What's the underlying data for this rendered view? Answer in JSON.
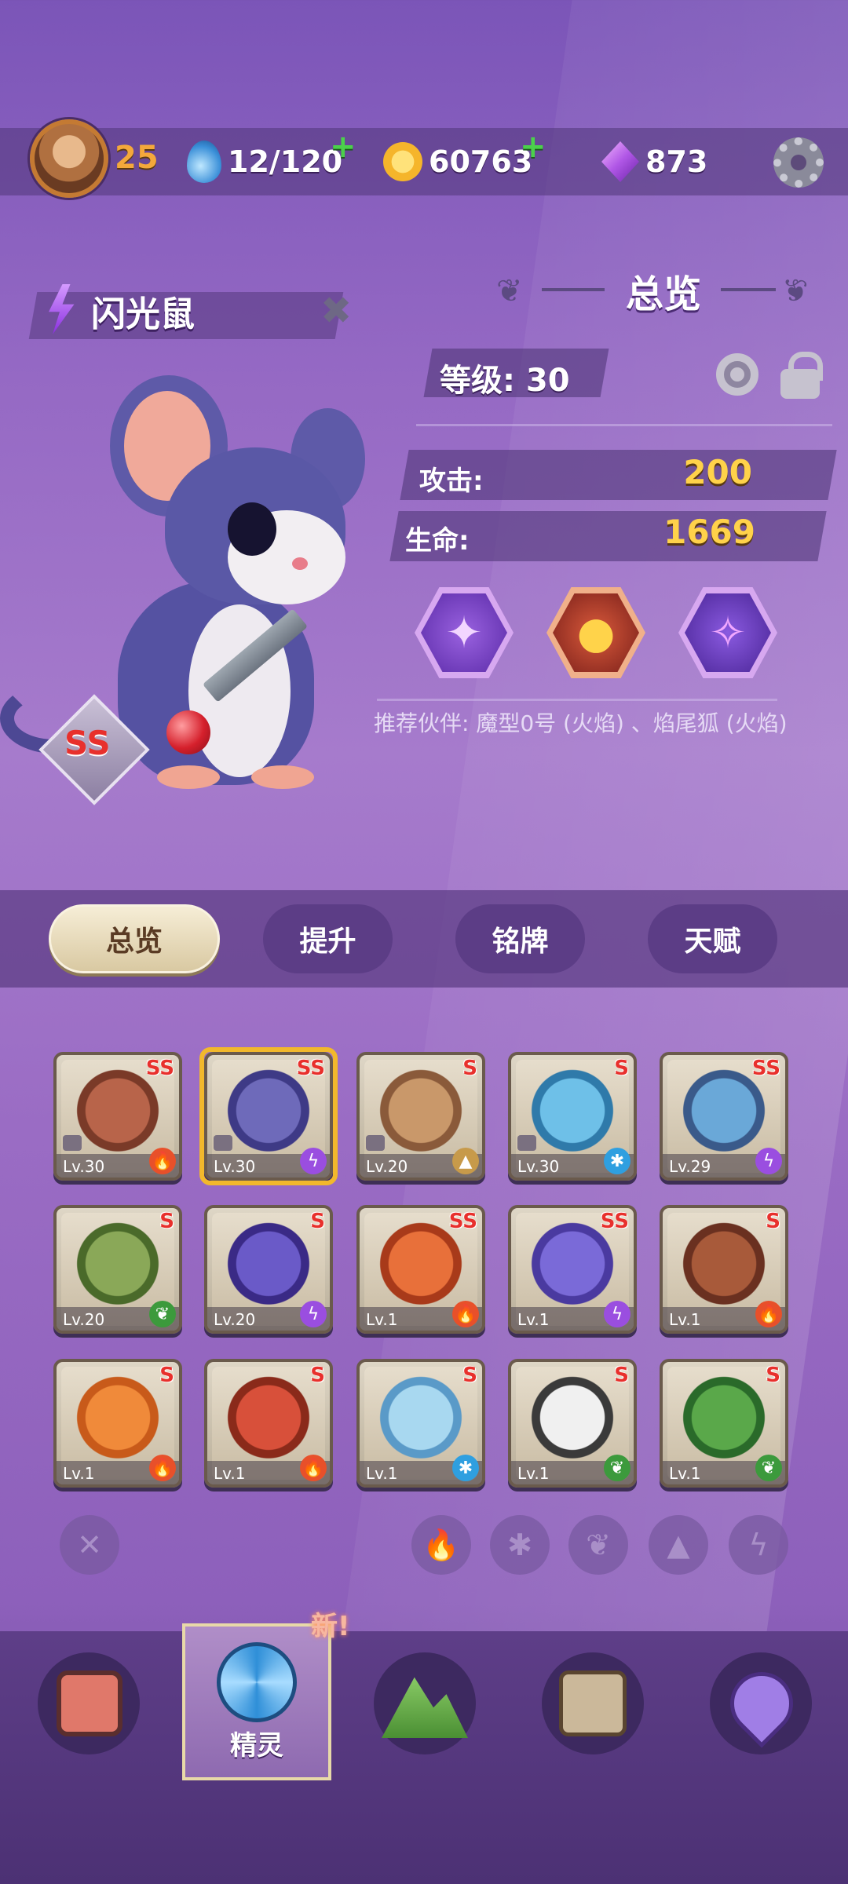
{
  "player": {
    "level": "25"
  },
  "resources": {
    "energy": "12/120",
    "coins": "60763",
    "gems": "873"
  },
  "pet": {
    "name": "闪光鼠",
    "rarity": "SS",
    "element": "lightning"
  },
  "overview": {
    "title": "总览",
    "level_label": "等级: 30",
    "attack_label": "攻击:",
    "attack_value": "200",
    "hp_label": "生命:",
    "hp_value": "1669",
    "partner_text": "推荐伙伴: 魔型0号 (火焰) 、焰尾狐 (火焰)"
  },
  "tabs": [
    {
      "label": "总览",
      "active": true
    },
    {
      "label": "提升"
    },
    {
      "label": "铭牌"
    },
    {
      "label": "天赋"
    }
  ],
  "pets": [
    {
      "rarity": "SS",
      "level": "Lv.30",
      "element": "fire",
      "locked": true
    },
    {
      "rarity": "SS",
      "level": "Lv.30",
      "element": "lightning",
      "locked": true,
      "selected": true
    },
    {
      "rarity": "S",
      "level": "Lv.20",
      "element": "earth",
      "locked": true
    },
    {
      "rarity": "S",
      "level": "Lv.30",
      "element": "ice",
      "locked": true
    },
    {
      "rarity": "SS",
      "level": "Lv.29",
      "element": "lightning"
    },
    {
      "rarity": "S",
      "level": "Lv.20",
      "element": "nature"
    },
    {
      "rarity": "S",
      "level": "Lv.20",
      "element": "lightning"
    },
    {
      "rarity": "SS",
      "level": "Lv.1",
      "element": "fire"
    },
    {
      "rarity": "SS",
      "level": "Lv.1",
      "element": "lightning"
    },
    {
      "rarity": "S",
      "level": "Lv.1",
      "element": "fire"
    },
    {
      "rarity": "S",
      "level": "Lv.1",
      "element": "fire"
    },
    {
      "rarity": "S",
      "level": "Lv.1",
      "element": "fire"
    },
    {
      "rarity": "S",
      "level": "Lv.1",
      "element": "ice"
    },
    {
      "rarity": "S",
      "level": "Lv.1",
      "element": "nature"
    },
    {
      "rarity": "S",
      "level": "Lv.1",
      "element": "nature"
    }
  ],
  "bottom_nav": {
    "active_label": "精灵",
    "new_badge": "新!"
  },
  "colors": {
    "accent_gold": "#ffd24a",
    "rarity_red": "#e8302c",
    "fire": "#e8502a",
    "lightning": "#9a4ee0",
    "ice": "#2f9fe0",
    "nature": "#3c9a3c",
    "earth": "#c79a4a"
  }
}
